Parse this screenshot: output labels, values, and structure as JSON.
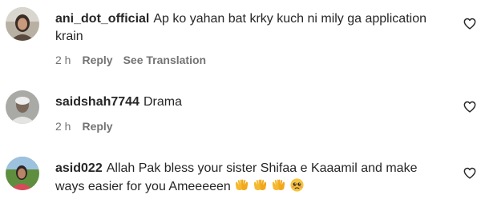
{
  "comments": [
    {
      "username": "ani_dot_official",
      "text": "Ap ko yahan bat krky kuch ni mily ga application krain",
      "time": "2 h",
      "reply_label": "Reply",
      "translation_label": "See Translation",
      "like_icon": "heart-outline-icon"
    },
    {
      "username": "saidshah7744",
      "text": "Drama",
      "time": "2 h",
      "reply_label": "Reply",
      "like_icon": "heart-outline-icon"
    },
    {
      "username": "asid022",
      "text": "Allah Pak bless your sister Shifaa e Kaaamil and make ways easier for you Ameeeeen",
      "emojis": [
        "open-hands-emoji",
        "open-hands-emoji",
        "open-hands-emoji",
        "pleading-face-emoji"
      ],
      "like_icon": "heart-outline-icon"
    }
  ],
  "colors": {
    "text": "#262626",
    "secondary": "#737373"
  }
}
